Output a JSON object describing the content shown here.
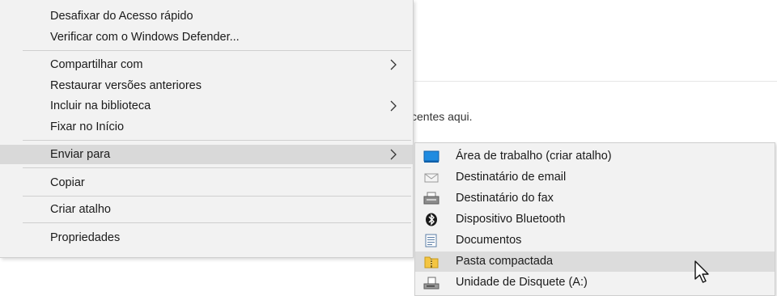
{
  "background": {
    "text": "centes aqui."
  },
  "context_menu": {
    "items": [
      {
        "label": "Desafixar do Acesso rápido"
      },
      {
        "label": "Verificar com o Windows Defender..."
      },
      {
        "label": "Compartilhar com"
      },
      {
        "label": "Restaurar versões anteriores"
      },
      {
        "label": "Incluir na biblioteca"
      },
      {
        "label": "Fixar no Início"
      },
      {
        "label": "Enviar para"
      },
      {
        "label": "Copiar"
      },
      {
        "label": "Criar atalho"
      },
      {
        "label": "Propriedades"
      }
    ]
  },
  "send_to_submenu": {
    "items": [
      {
        "label": "Área de trabalho (criar atalho)",
        "icon": "desktop-icon"
      },
      {
        "label": "Destinatário de email",
        "icon": "mail-icon"
      },
      {
        "label": "Destinatário do fax",
        "icon": "fax-icon"
      },
      {
        "label": "Dispositivo Bluetooth",
        "icon": "bluetooth-icon"
      },
      {
        "label": "Documentos",
        "icon": "documents-icon"
      },
      {
        "label": "Pasta compactada",
        "icon": "zip-folder-icon"
      },
      {
        "label": "Unidade de Disquete (A:)",
        "icon": "floppy-drive-icon"
      }
    ]
  },
  "colors": {
    "menu_bg": "#f2f2f2",
    "highlight": "#d9d9d9",
    "separator": "#cfcfcf",
    "desktop_blue": "#1f8be0"
  }
}
